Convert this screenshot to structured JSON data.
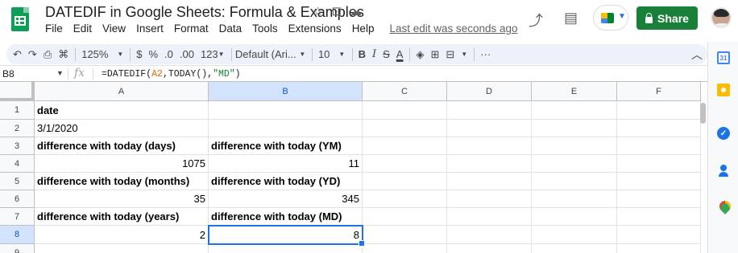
{
  "doc": {
    "title": "DATEDIF in Google Sheets: Formula & Examples",
    "menu": [
      "File",
      "Edit",
      "View",
      "Insert",
      "Format",
      "Data",
      "Tools",
      "Extensions",
      "Help"
    ],
    "last_edit": "Last edit was seconds ago",
    "share_label": "Share"
  },
  "toolbar": {
    "zoom": "125%",
    "currency": "$",
    "percent": "%",
    "dec_decrease": ".0",
    "dec_increase": ".00",
    "more_formats": "123",
    "font": "Default (Ari...",
    "font_size": "10",
    "bold": "B",
    "italic": "I",
    "strike": "S",
    "text_color": "A",
    "more": "···"
  },
  "formula_bar": {
    "name_box": "B8",
    "fx": "fx",
    "formula_prefix": "=DATEDIF(",
    "formula_ref": "A2",
    "formula_mid": ",TODAY(),",
    "formula_str": "\"MD\"",
    "formula_suffix": ")"
  },
  "sheet": {
    "columns": [
      "A",
      "B",
      "C",
      "D",
      "E",
      "F"
    ],
    "rows": [
      "1",
      "2",
      "3",
      "4",
      "5",
      "6",
      "7",
      "8",
      "9"
    ],
    "cells": {
      "A1": "date",
      "A2": "3/1/2020",
      "A3": "difference with today (days)",
      "B3": "difference with today (YM)",
      "A4": "1075",
      "B4": "11",
      "A5": "difference with today (months)",
      "B5": "difference with today (YD)",
      "A6": "35",
      "B6": "345",
      "A7": "difference with today (years)",
      "B7": "difference with today (MD)",
      "A8": "2",
      "B8": "8"
    },
    "selected_cell": "B8"
  },
  "side_panel": {
    "calendar_day": "31"
  },
  "colors": {
    "share_green": "#188038",
    "selection_blue": "#1a73e8",
    "sheets_green": "#0f9d58"
  }
}
